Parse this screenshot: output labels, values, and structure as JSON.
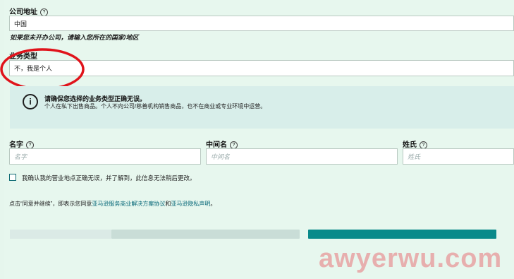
{
  "company_address": {
    "label": "公司地址",
    "help": "?",
    "value": "中国",
    "hint": "如果您未开办公司，请输入您所在的国家/地区"
  },
  "business_type": {
    "label": "业务类型",
    "value": "不，我是个人"
  },
  "info": {
    "icon": "i",
    "title": "请确保您选择的业务类型正确无误。",
    "text": "个人在私下出售商品。个人不向公司/慈善机构销售商品，也不在商业或专业环境中运营。"
  },
  "name_fields": {
    "first": {
      "label": "名字",
      "help": "?",
      "placeholder": "名字"
    },
    "middle": {
      "label": "中间名",
      "help": "?",
      "placeholder": "中间名"
    },
    "last": {
      "label": "姓氏",
      "help": "?",
      "placeholder": "姓氏"
    }
  },
  "confirm_checkbox": {
    "label": "我确认我的营业地点正确无误，并了解到，此信息无法稍后更改。"
  },
  "agreement": {
    "prefix": "点击“同意并继续”，即表示您同意",
    "link1": "亚马逊服务商业解决方案协议",
    "middle": "和",
    "link2": "亚马逊隐私声明",
    "suffix": "。"
  },
  "watermark": "awyerwu.com",
  "colors": {
    "background": "#e7f7ee",
    "accent": "#0a8a8a",
    "annotation": "#e0131b"
  }
}
